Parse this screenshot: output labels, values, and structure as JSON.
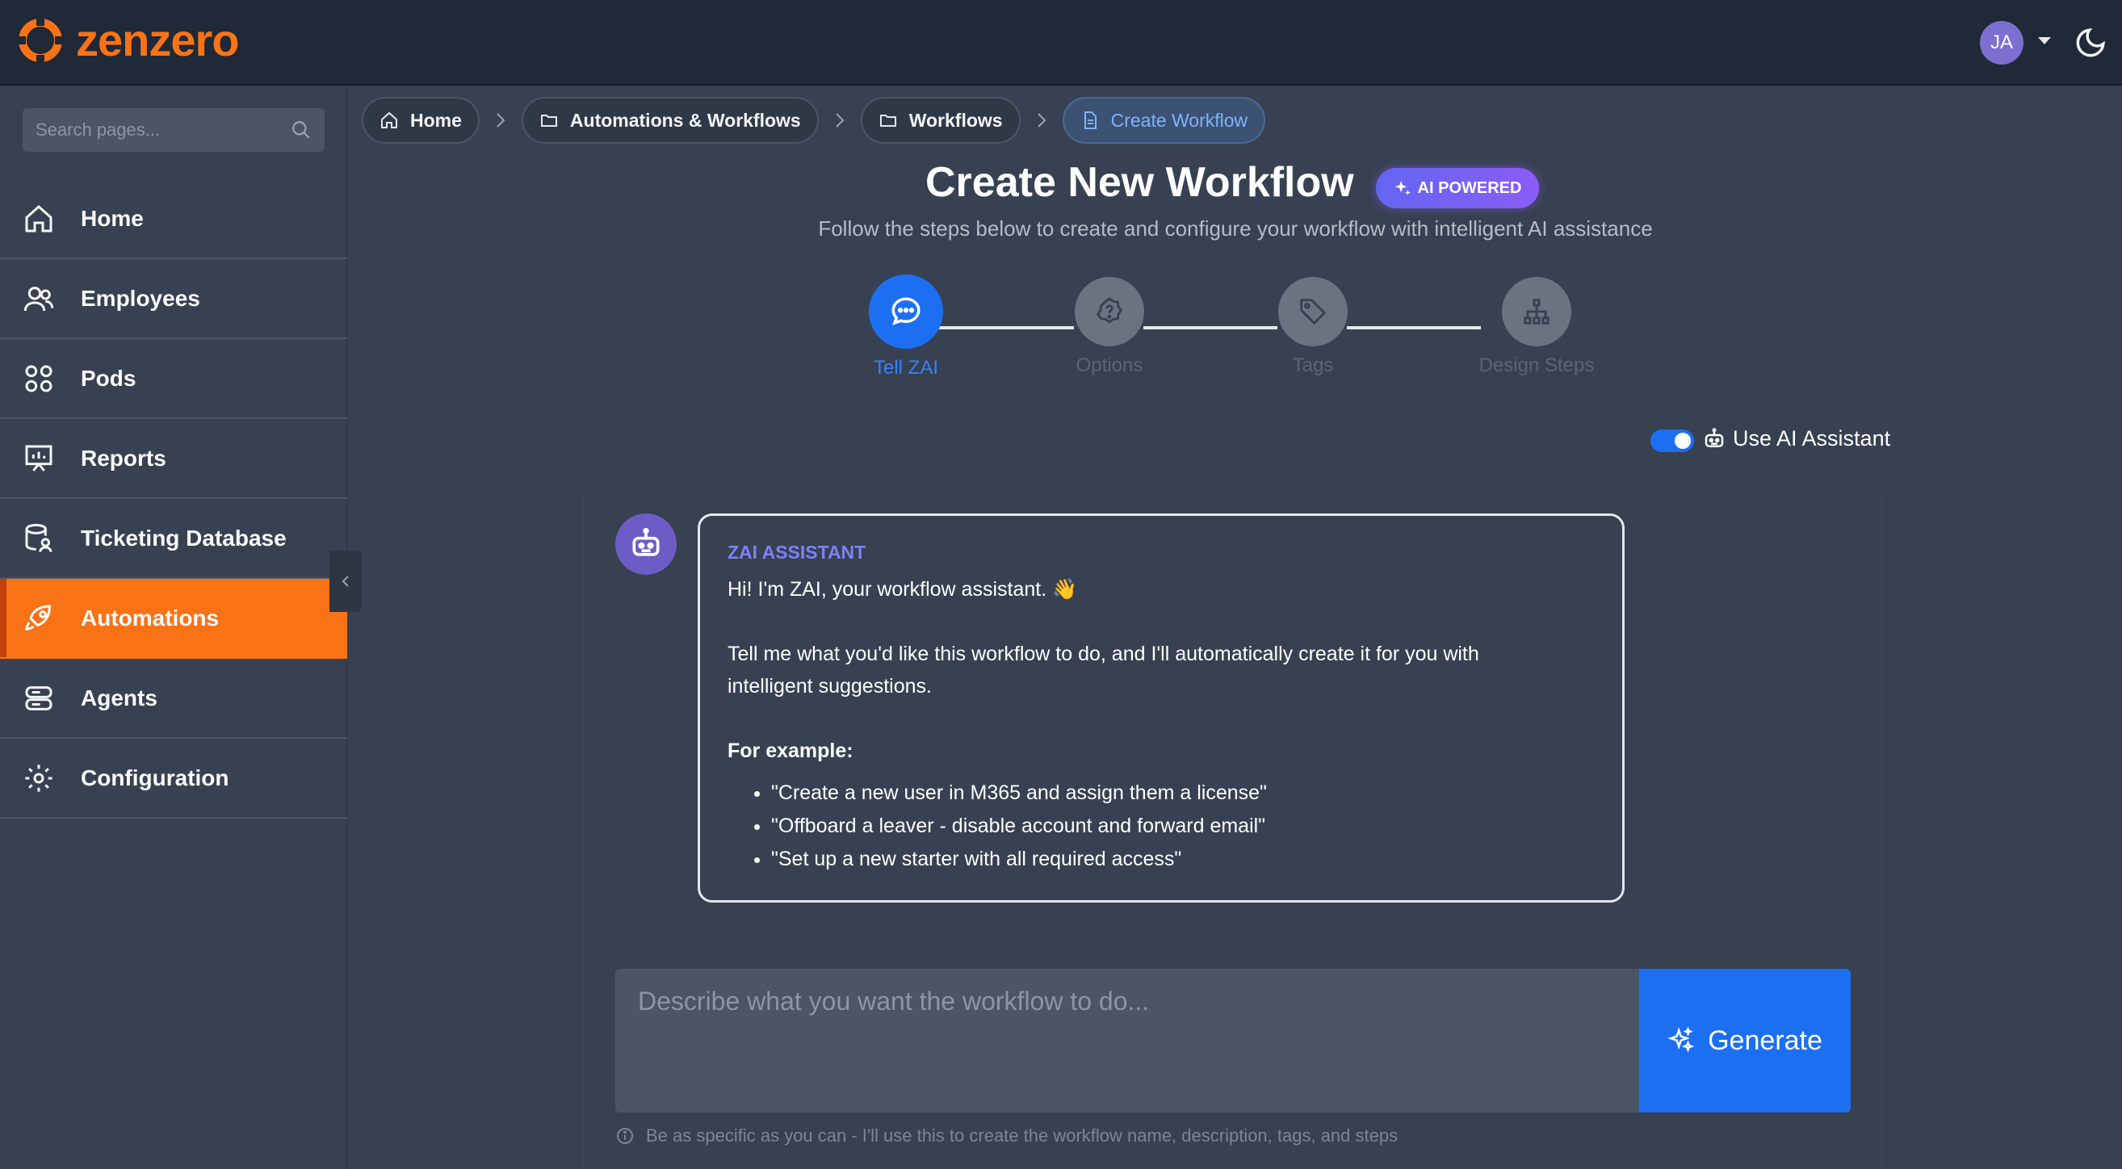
{
  "brand": {
    "name": "zenzero",
    "accent": "#f97316"
  },
  "user": {
    "initials": "JA"
  },
  "sidebar": {
    "search_placeholder": "Search pages...",
    "items": [
      {
        "label": "Home",
        "icon": "home-icon",
        "active": false
      },
      {
        "label": "Employees",
        "icon": "users-icon",
        "active": false
      },
      {
        "label": "Pods",
        "icon": "grid-icon",
        "active": false
      },
      {
        "label": "Reports",
        "icon": "presentation-icon",
        "active": false
      },
      {
        "label": "Ticketing Database",
        "icon": "database-user-icon",
        "active": false
      },
      {
        "label": "Automations",
        "icon": "rocket-icon",
        "active": true
      },
      {
        "label": "Agents",
        "icon": "server-icon",
        "active": false
      },
      {
        "label": "Configuration",
        "icon": "gear-icon",
        "active": false
      }
    ]
  },
  "breadcrumb": [
    {
      "label": "Home",
      "icon": "home-icon"
    },
    {
      "label": "Automations & Workflows",
      "icon": "folder-icon"
    },
    {
      "label": "Workflows",
      "icon": "folder-icon"
    },
    {
      "label": "Create Workflow",
      "icon": "document-icon"
    }
  ],
  "header": {
    "title": "Create New Workflow",
    "badge": "AI POWERED",
    "subtitle": "Follow the steps below to create and configure your workflow with intelligent AI assistance"
  },
  "steps": [
    {
      "label": "Tell ZAI",
      "icon": "chat-icon",
      "active": true
    },
    {
      "label": "Options",
      "icon": "question-icon",
      "active": false
    },
    {
      "label": "Tags",
      "icon": "tag-icon",
      "active": false
    },
    {
      "label": "Design Steps",
      "icon": "sitemap-icon",
      "active": false
    }
  ],
  "ai_toggle": {
    "label": "Use AI Assistant",
    "on": true
  },
  "assistant": {
    "name": "ZAI ASSISTANT",
    "greeting": "Hi! I'm ZAI, your workflow assistant. 👋",
    "intro": "Tell me what you'd like this workflow to do, and I'll automatically create it for you with intelligent suggestions.",
    "examples_heading": "For example:",
    "examples": [
      "\"Create a new user in M365 and assign them a license\"",
      "\"Offboard a leaver - disable account and forward email\"",
      "\"Set up a new starter with all required access\""
    ]
  },
  "composer": {
    "placeholder": "Describe what you want the workflow to do...",
    "button": "Generate",
    "hint": "Be as specific as you can - I'll use this to create the workflow name, description, tags, and steps"
  }
}
